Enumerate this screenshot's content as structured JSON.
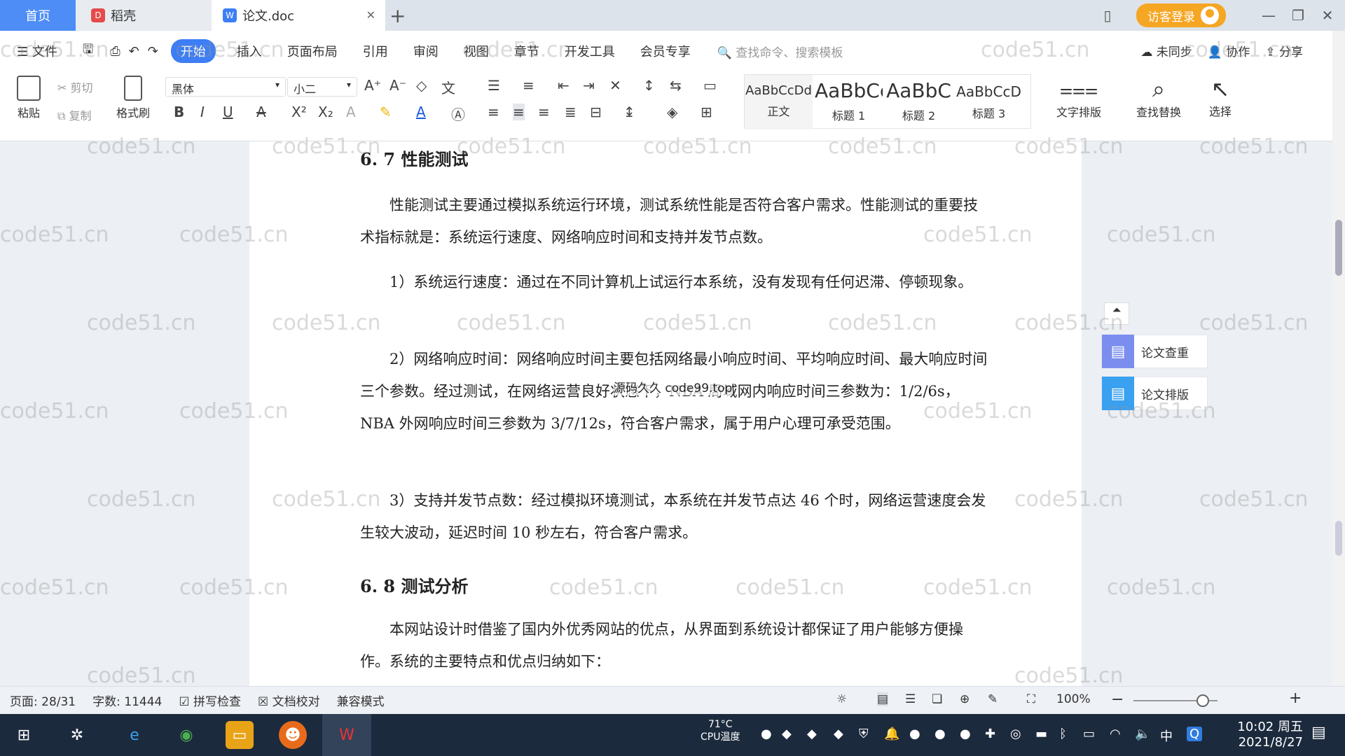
{
  "tabs": [
    {
      "label": "首页"
    },
    {
      "label": "稻壳"
    },
    {
      "label": "论文.doc"
    }
  ],
  "window": {
    "login": "访客登录"
  },
  "menu": {
    "file": "文件",
    "items": [
      "开始",
      "插入",
      "页面布局",
      "引用",
      "审阅",
      "视图",
      "章节",
      "开发工具",
      "会员专享"
    ],
    "search": "查找命令、搜索模板",
    "sync": "未同步",
    "collab": "协作",
    "share": "分享"
  },
  "ribbon": {
    "paste": "粘贴",
    "cut": "剪切",
    "copy": "复制",
    "format_painter": "格式刷",
    "font": "黑体",
    "size": "小二",
    "styles": [
      {
        "preview": "AaBbCcDd",
        "label": "正文"
      },
      {
        "preview": "AaBbCc",
        "label": "标题 1"
      },
      {
        "preview": "AaBbC",
        "label": "标题 2"
      },
      {
        "preview": "AaBbCcD",
        "label": "标题 3"
      }
    ],
    "text_layout": "文字排版",
    "find_replace": "查找替换",
    "select": "选择"
  },
  "document": {
    "h1": "6. 7 性能测试",
    "p1": "性能测试主要通过模拟系统运行环境，测试系统性能是否符合客户需求。性能测试的重要技术指标就是：系统运行速度、网络响应时间和支持并发节点数。",
    "p2": "1）系统运行速度：通过在不同计算机上试运行本系统，没有发现有任何迟滞、停顿现象。",
    "p3": "2）网络响应时间：网络响应时间主要包括网络最小响应时间、平均响应时间、最大响应时间三个参数。经过测试，在网络运营良好状态下，NBA 局域网内响应时间三参数为：1/2/6s，NBA 外网响应时间三参数为 3/7/12s，符合客户需求，属于用户心理可承受范围。",
    "p4": "3）支持并发节点数：经过模拟环境测试，本系统在并发节点达 46 个时，网络运营速度会发生较大波动，延迟时间 10 秒左右，符合客户需求。",
    "h2": "6. 8 测试分析",
    "p5": "本网站设计时借鉴了国内外优秀网站的优点，从界面到系统设计都保证了用户能够方便操作。系统的主要特点和优点归纳如下：",
    "overlay": "源码久久 code99.top"
  },
  "watermark": "code51.cn",
  "side": {
    "check": "论文查重",
    "layout": "论文排版"
  },
  "status": {
    "page": "页面: 28/31",
    "words": "字数: 11444",
    "spell": "拼写检查",
    "proof": "文档校对",
    "compat": "兼容模式",
    "zoom": "100%"
  },
  "taskbar": {
    "temp": "71°C",
    "temp_label": "CPU温度",
    "ime": "中",
    "time": "10:02 周五",
    "date": "2021/8/27"
  },
  "colors": {
    "accent": "#3d7ef5",
    "login": "#f5a623",
    "taskbar": "#1c2a3d"
  }
}
